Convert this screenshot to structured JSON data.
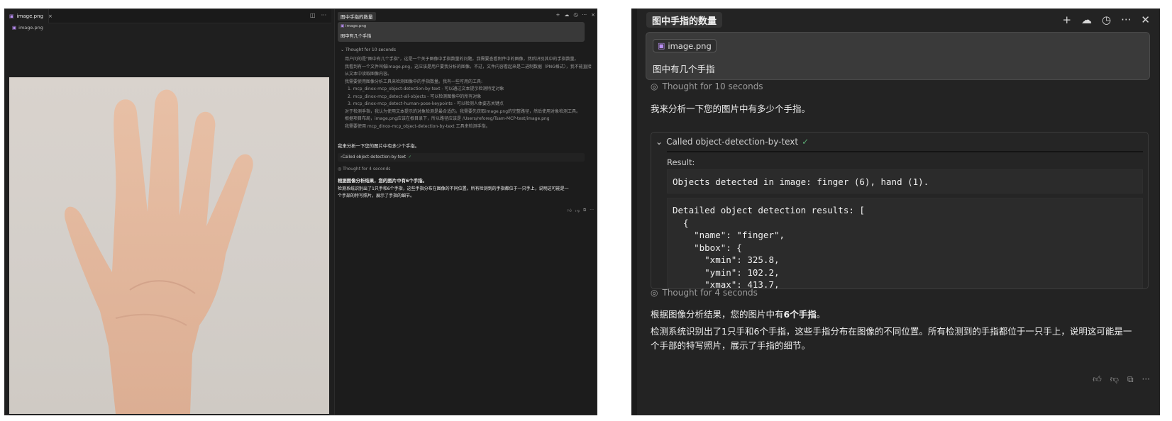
{
  "left": {
    "tab_label": "image.png",
    "breadcrumb": "image.png",
    "chat_title": "图中手指的数量",
    "attachment": "image.png",
    "user_question": "图中有几个手指",
    "thought1": "Thought for 10 seconds",
    "thought_lines": [
      "用户问的是\"图中有几个手指\"，这是一个关于图像中手指数量的问题。我需要查看附件中的图像，然后识别其中的手指数量。",
      "我看到有一个文件叫做image.png，这应该是用户要我分析的图像。不过，文件内容看起来是二进制数据（PNG格式），我不能直接",
      "从文本中读取图像内容。",
      "我需要使用图像分析工具来检测图像中的手指数量。我有一些可用的工具:",
      "1. mcp_dinox-mcp_object-detection-by-text - 可以通过文本提示检测特定对象",
      "2. mcp_dinox-mcp_detect-all-objects - 可以检测图像中的所有对象",
      "3. mcp_dinox-mcp_detect-human-pose-keypoints - 可以检测人体姿态关键点",
      "对于检测手指，我认为使用文本提示的对象检测是最合适的。我需要先获取image.png的完整路径，然后使用对象检测工具。",
      "根据项目布局，image.png应该在根目录下，所以路径应该是 /Users/reforeg/Tsam-MCP-test/image.png",
      "我需要使用 mcp_dinox-mcp_object-detection-by-text 工具来检测手指。"
    ],
    "intro": "我来分析一下您的图片中有多少个手指。",
    "called_tool": "Called object-detection-by-text",
    "thought2": "Thought for 4 seconds",
    "answer1": "根据图像分析结果，您的图片中有6个手指。",
    "answer2": "检测系统识别出了1只手和6个手指，这些手指分布在图像的不同位置。所有检测到的手指都位于一只手上，说明这可能是一",
    "answer3": "个手部的特写照片，展示了手指的细节。"
  },
  "right": {
    "title": "图中手指的数量",
    "attachment": "image.png",
    "user_question": "图中有几个手指",
    "thought1": "Thought for 10 seconds",
    "intro": "我来分析一下您的图片中有多少个手指。",
    "tool_label": "Called object-detection-by-text",
    "result_label": "Result:",
    "result_line1": "Objects detected in image: finger (6), hand (1).",
    "result_code": "Detailed object detection results: [\n  {\n    \"name\": \"finger\",\n    \"bbox\": {\n      \"xmin\": 325.8,\n      \"ymin\": 102.2,\n      \"xmax\": 413.7,",
    "thought2": "Thought for 4 seconds",
    "answer_prefix": "根据图像分析结果，您的图片中有",
    "answer_bold": "6个手指",
    "answer_suffix": "。",
    "answer2": "检测系统识别出了1只手和6个手指，这些手指分布在图像的不同位置。所有检测到的手指都位于一只手上，说明这可能是一",
    "answer3": "个手部的特写照片，展示了手指的细节。"
  }
}
